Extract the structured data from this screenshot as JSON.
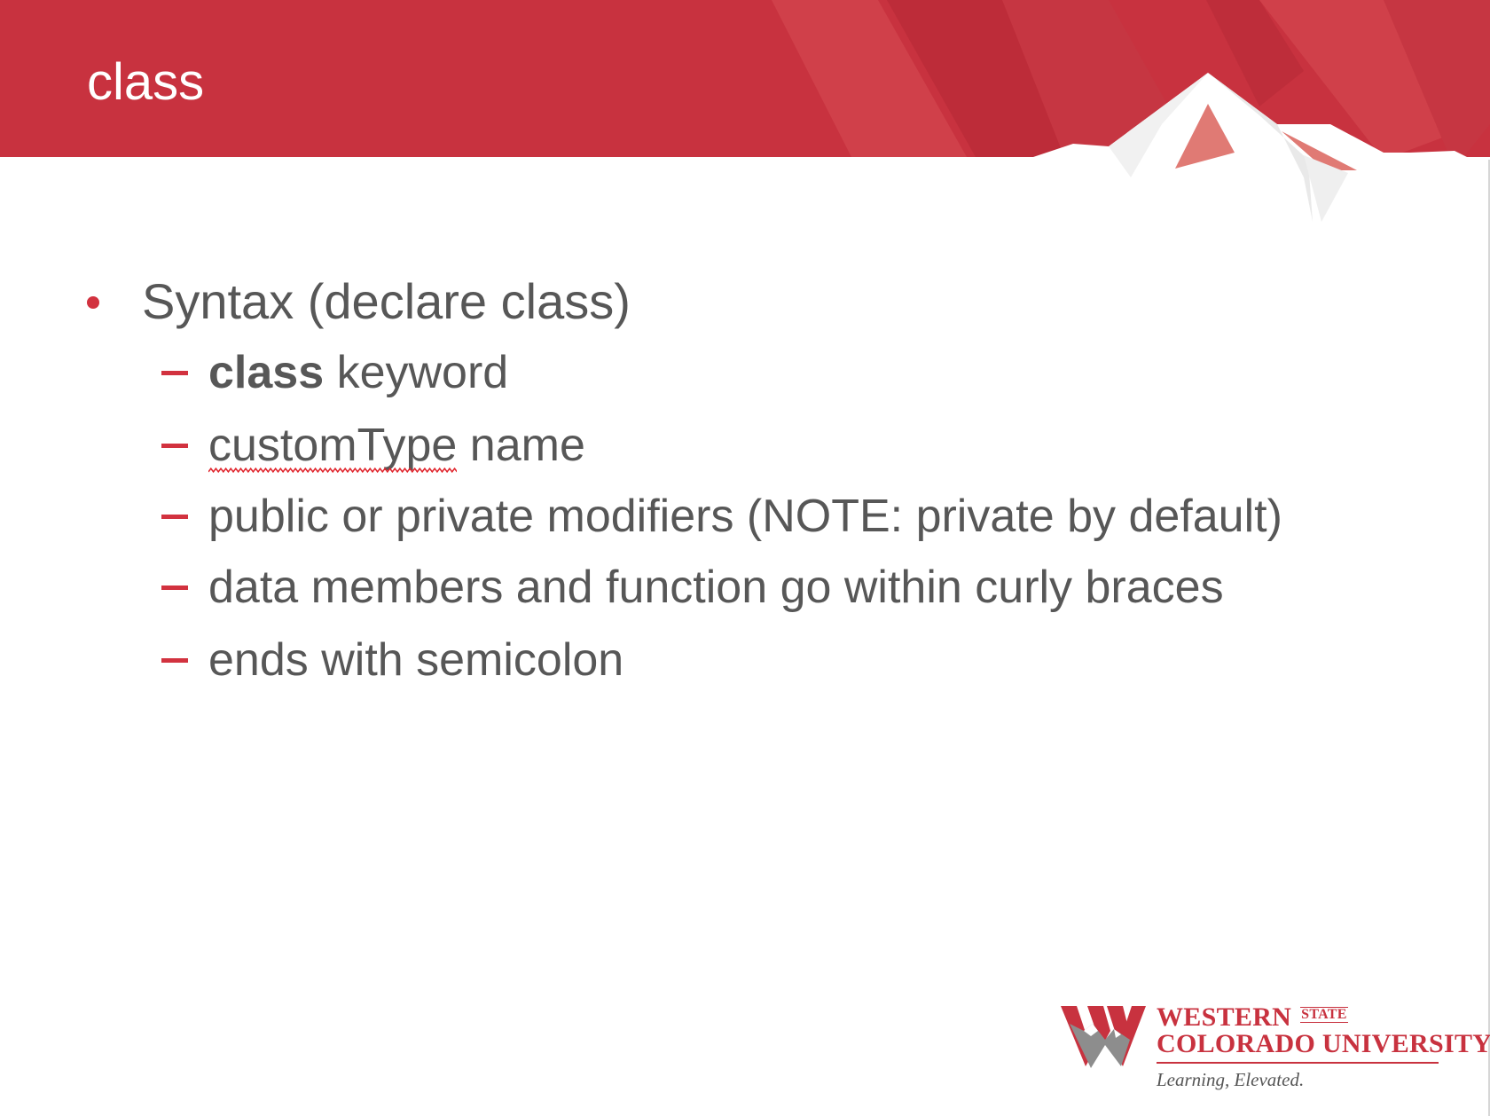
{
  "slide": {
    "title": "class",
    "bullet": "Syntax (declare class)",
    "sub_items": [
      {
        "bold": "class",
        "text": " keyword"
      },
      {
        "squiggle_word": "customType",
        "text": " name"
      },
      {
        "text": "public or private modifiers (NOTE: private by default)"
      },
      {
        "text": "data members and function go within curly braces"
      },
      {
        "text": "ends with semicolon"
      }
    ]
  },
  "logo": {
    "line1": "WESTERN",
    "state": "STATE",
    "line2": "COLORADO UNIVERSITY",
    "tagline": "Learning, Elevated."
  },
  "colors": {
    "header_red": "#c8323f",
    "accent_red": "#d2323f",
    "text_gray": "#575757"
  }
}
